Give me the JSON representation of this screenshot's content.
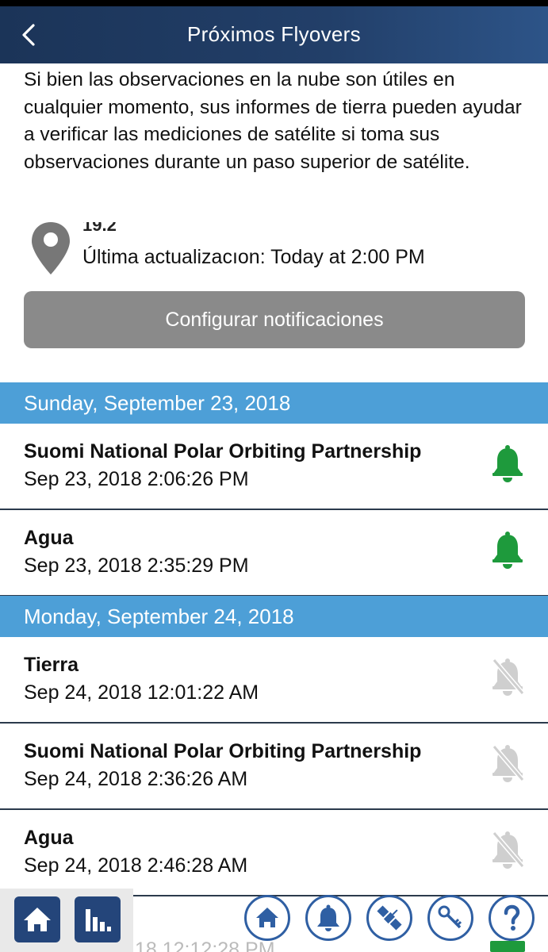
{
  "header": {
    "title": "Próximos Flyovers"
  },
  "intro": {
    "text": "Si bien las observaciones en la nube son útiles en cualquier momento, sus informes de tierra pueden ayudar a verificar las mediciones de satélite si toma sus observaciones durante un paso superior de satélite."
  },
  "location": {
    "coords_partial": "19.2",
    "updated": "Última actualizacıon: Today at 2:00 PM"
  },
  "buttons": {
    "configure": "Configurar notificaciones"
  },
  "days": [
    {
      "label": "Sunday, September 23, 2018",
      "passes": [
        {
          "satellite": "Suomi National Polar Orbiting Partnership",
          "time": "Sep 23, 2018 2:06:26 PM",
          "notify": true
        },
        {
          "satellite": "Agua",
          "time": "Sep 23, 2018 2:35:29 PM",
          "notify": true
        }
      ]
    },
    {
      "label": "Monday, September 24, 2018",
      "passes": [
        {
          "satellite": "Tierra",
          "time": "Sep 24, 2018 12:01:22 AM",
          "notify": false
        },
        {
          "satellite": "Suomi National Polar Orbiting Partnership",
          "time": "Sep 24, 2018 2:36:26 AM",
          "notify": false
        },
        {
          "satellite": "Agua",
          "time": "Sep 24, 2018 2:46:28 AM",
          "notify": false
        }
      ]
    }
  ],
  "partial_row": {
    "time_fragment": "18 12:12:28 PM"
  },
  "colors": {
    "header": "#223f69",
    "day_header": "#4d9fd7",
    "bell_on": "#1e9a3c",
    "bell_off": "#cfcfcf",
    "button": "#8a8a8a",
    "nav_accent": "#2f5fa3"
  },
  "icons": {
    "back": "chevron-left-icon",
    "location": "map-pin-icon",
    "bell_on": "bell-icon",
    "bell_off": "bell-off-icon",
    "nav": [
      "home-icon",
      "bar-chart-icon",
      "home-icon",
      "bell-icon",
      "satellite-icon",
      "key-icon",
      "help-icon"
    ]
  }
}
